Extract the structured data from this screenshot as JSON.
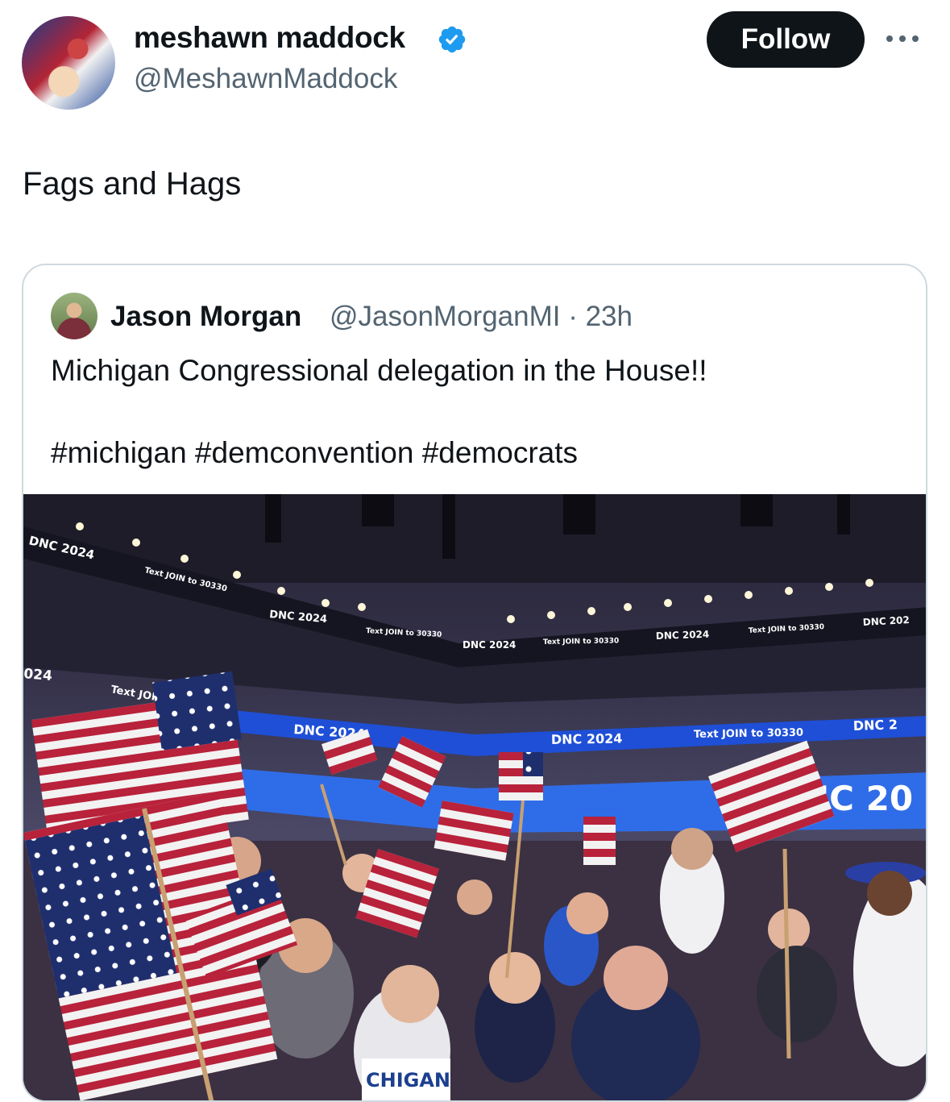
{
  "tweet": {
    "author_name": "meshawn maddock",
    "author_handle": "@MeshawnMaddock",
    "verified_icon": "verified-badge-icon",
    "follow_label": "Follow",
    "more_icon": "more-options-icon",
    "text": "Fags and Hags"
  },
  "quoted": {
    "author_name": "Jason Morgan",
    "author_handle_time": "@JasonMorganMI · 23h",
    "text": "Michigan Congressional delegation in the House!!",
    "hashtags": "#michigan #demconvention #democrats",
    "photo": {
      "signs": {
        "upper1": "DNC 2024",
        "upper2": "Text JOIN to 30330",
        "upper3": "DNC 2024",
        "upper4": "Text JOIN to 30330",
        "upper5": "DNC 2024",
        "upper6": "Text JOIN to 30330",
        "upper7": "DNC 2024",
        "upper8": "Text JOIN to 30330",
        "upper9": "DNC 202",
        "left_edge": "024",
        "left_text": "Text JOIN",
        "lower1": "DNC 2024",
        "lower2": "DNC 2024",
        "lower3": "Text JOIN to 30330",
        "lower4": "DNC 2",
        "big_screen": "NC 20",
        "banner": "CHIGAN"
      }
    }
  },
  "colors": {
    "accent_blue": "#1d9bf0",
    "text_primary": "#0f1419",
    "text_secondary": "#536471",
    "border": "#cfd9de",
    "ticker_blue": "#1e4fd6"
  }
}
